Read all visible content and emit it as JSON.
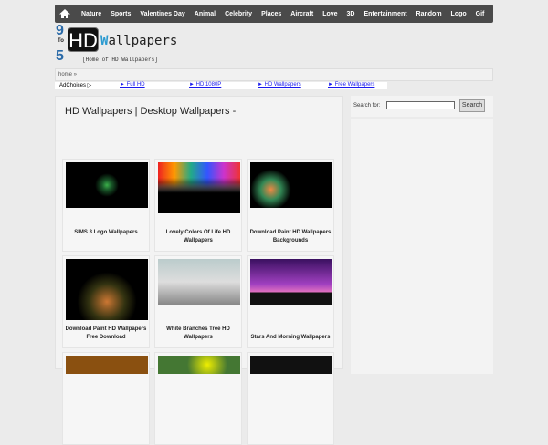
{
  "nav": {
    "items": [
      "Nature",
      "Sports",
      "Valentines Day",
      "Animal",
      "Celebrity",
      "Places",
      "Aircraft",
      "Love",
      "3D",
      "Entertainment",
      "Random",
      "Logo",
      "Gif"
    ]
  },
  "logo": {
    "n1": "9",
    "n2": "To",
    "n3": "5",
    "hd": "HD",
    "w": "W",
    "rest": "allpapers",
    "tagline": "[Home of HD Wallpapers]"
  },
  "breadcrumb": "home »",
  "ads": {
    "adchoices": "AdChoices ▷",
    "links": [
      "► Full HD",
      "► HD 1080P",
      "► HD Wallpapers",
      "► Free Wallpapers"
    ]
  },
  "main": {
    "title": "HD Wallpapers | Desktop Wallpapers -"
  },
  "cards": [
    "SIMS 3 Logo Wallpapers",
    "Lovely Colors Of Life HD Wallpapers",
    "Download Paint HD Wallpapers Backgrounds",
    "Download Paint HD Wallpapers Free Download",
    "White Branches Tree HD Wallpapers",
    "Stars And Morning Wallpapers",
    "",
    "",
    ""
  ],
  "search": {
    "label": "Search for:",
    "button": "Search",
    "value": ""
  }
}
